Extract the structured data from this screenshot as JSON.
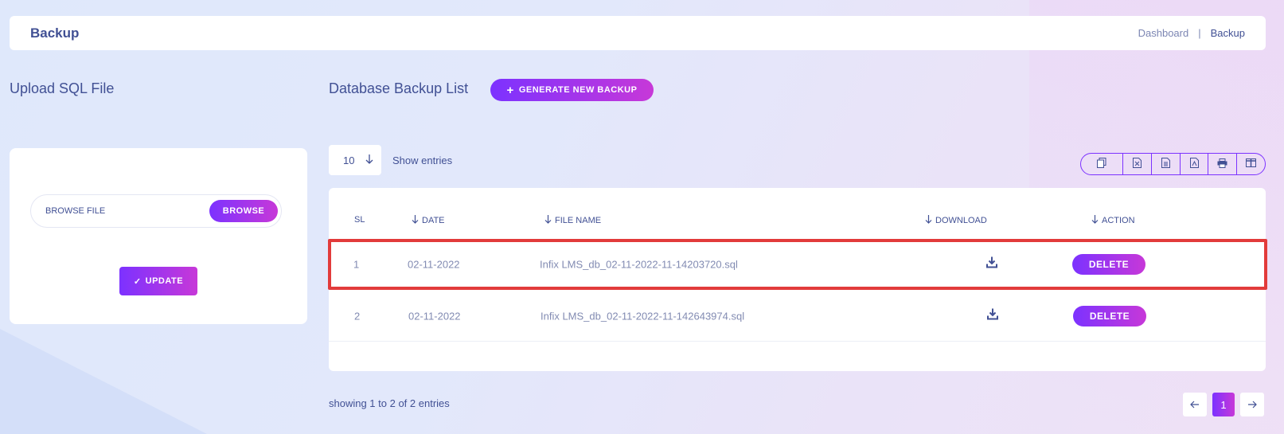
{
  "header": {
    "title": "Backup",
    "breadcrumb": [
      "Dashboard",
      "Backup"
    ],
    "separator": "|"
  },
  "upload": {
    "title": "Upload SQL File",
    "file_placeholder": "BROWSE FILE",
    "browse_label": "BROWSE",
    "update_label": "UPDATE"
  },
  "backup_list": {
    "title": "Database Backup List",
    "generate_label": "GENERATE NEW BACKUP",
    "page_size": "10",
    "show_entries": "Show entries",
    "export_icons": [
      "copy-icon",
      "excel-icon",
      "csv-icon",
      "pdf-icon",
      "print-icon",
      "columns-icon"
    ],
    "columns": {
      "sl": "SL",
      "date": "DATE",
      "file_name": "FILE NAME",
      "download": "DOWNLOAD",
      "action": "ACTION"
    },
    "rows": [
      {
        "sl": "1",
        "date": "02-11-2022",
        "file_name": "Infix LMS_db_02-11-2022-11-14203720.sql",
        "action": "DELETE"
      },
      {
        "sl": "2",
        "date": "02-11-2022",
        "file_name": "Infix LMS_db_02-11-2022-11-142643974.sql",
        "action": "DELETE"
      }
    ],
    "showing": "showing 1 to 2 of 2 entries",
    "current_page": "1"
  },
  "colors": {
    "accent_start": "#7c32ff",
    "accent_end": "#c738d8",
    "highlight": "#e23b3b",
    "text": "#415094"
  }
}
